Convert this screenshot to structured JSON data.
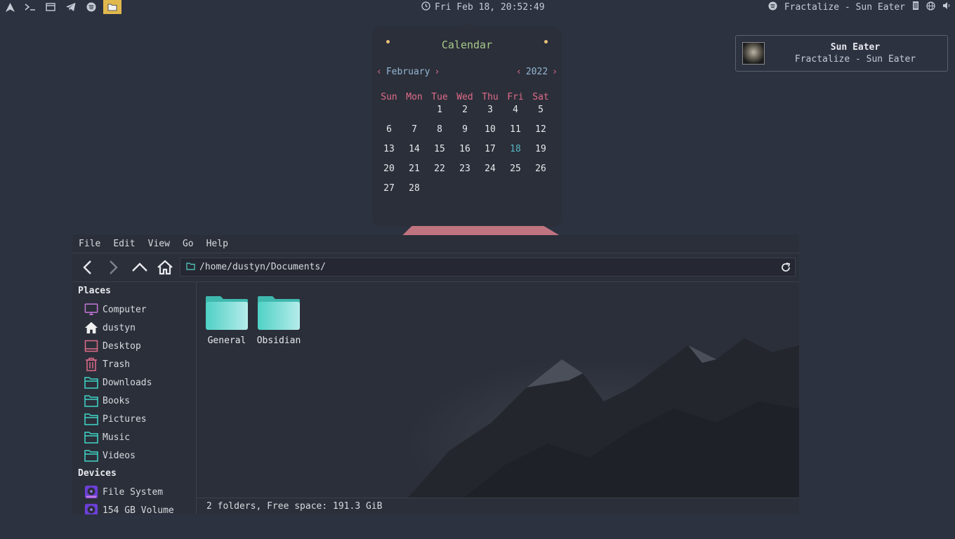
{
  "topbar": {
    "clock": "Fri Feb 18, 20:52:49",
    "now_playing": "Fractalize - Sun Eater",
    "left_icons": [
      "arch-icon",
      "terminal-icon",
      "browser-icon",
      "telegram-icon",
      "spotify-icon",
      "folder-icon"
    ],
    "right_icons": [
      "spotify-icon",
      "memory-icon",
      "network-icon",
      "volume-icon"
    ],
    "accent": "#e0b84d"
  },
  "calendar": {
    "title": "Calendar",
    "month": "February",
    "year": "2022",
    "weekdays": [
      "Sun",
      "Mon",
      "Tue",
      "Wed",
      "Thu",
      "Fri",
      "Sat"
    ],
    "days": [
      "",
      "",
      "1",
      "2",
      "3",
      "4",
      "5",
      "6",
      "7",
      "8",
      "9",
      "10",
      "11",
      "12",
      "13",
      "14",
      "15",
      "16",
      "17",
      "18",
      "19",
      "20",
      "21",
      "22",
      "23",
      "24",
      "25",
      "26",
      "27",
      "28",
      "",
      "",
      "",
      "",
      ""
    ],
    "today": "18",
    "colors": {
      "title": "#a6c98a",
      "weekday": "#e06c8a",
      "today": "#56b6c2",
      "dot": "#e6c07b"
    }
  },
  "notification": {
    "title": "Sun Eater",
    "body": "Fractalize - Sun Eater"
  },
  "filemanager": {
    "menu": [
      "File",
      "Edit",
      "View",
      "Go",
      "Help"
    ],
    "path": "/home/dustyn/Documents/",
    "places_title": "Places",
    "places": [
      {
        "label": "Computer",
        "icon": "computer-icon"
      },
      {
        "label": "dustyn",
        "icon": "home-icon"
      },
      {
        "label": "Desktop",
        "icon": "desktop-icon"
      },
      {
        "label": "Trash",
        "icon": "trash-icon"
      },
      {
        "label": "Downloads",
        "icon": "folder-icon"
      },
      {
        "label": "Books",
        "icon": "folder-icon"
      },
      {
        "label": "Pictures",
        "icon": "folder-icon"
      },
      {
        "label": "Music",
        "icon": "folder-icon"
      },
      {
        "label": "Videos",
        "icon": "folder-icon"
      }
    ],
    "devices_title": "Devices",
    "devices": [
      {
        "label": "File System",
        "icon": "drive-icon"
      },
      {
        "label": "154 GB Volume",
        "icon": "drive-icon"
      }
    ],
    "folders": [
      "General",
      "Obsidian"
    ],
    "status": "2 folders, Free space: 191.3 GiB",
    "folder_color": "#5fd3cf"
  }
}
